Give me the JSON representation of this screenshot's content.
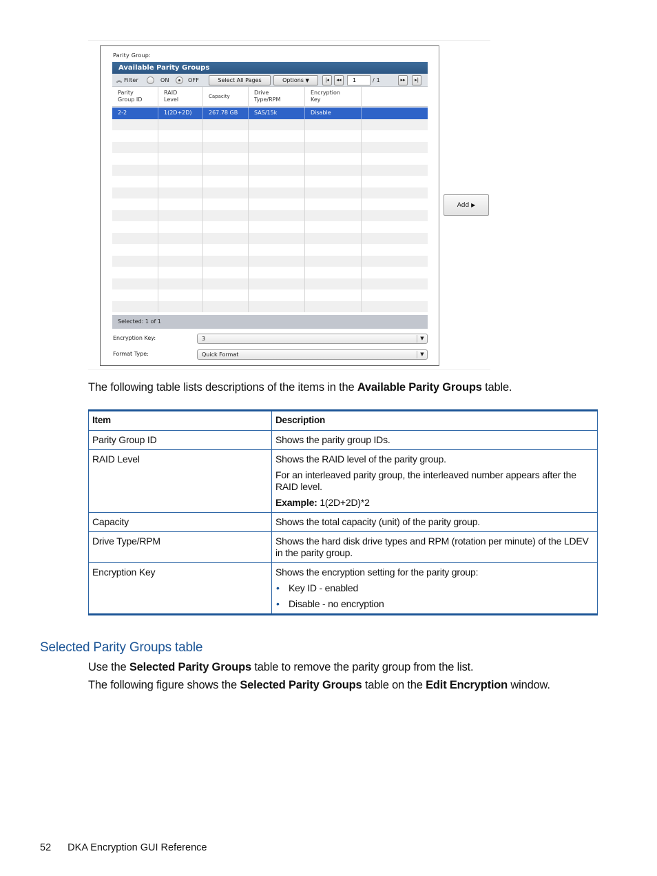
{
  "figure": {
    "parity_group_label": "Parity Group:",
    "grid_title": "Available Parity Groups",
    "toolbar": {
      "filter_label": "Filter",
      "filter_icon": "double-chevron-up-icon",
      "radio_on_label": "ON",
      "radio_off_label": "OFF",
      "filter_state": "OFF",
      "select_all_pages": "Select All Pages",
      "options": "Options",
      "first_page": "⏮",
      "prev_page": "◀◀",
      "page_value": "1",
      "page_total": "/ 1",
      "next_page": "▶▶",
      "last_page": "⏭"
    },
    "columns": [
      [
        "Parity",
        "Group ID"
      ],
      [
        "RAID",
        "Level"
      ],
      [
        "Capacity"
      ],
      [
        "Drive",
        "Type/RPM"
      ],
      [
        "Encryption",
        "Key"
      ],
      [
        ""
      ]
    ],
    "rows": [
      {
        "parity_group_id": "2-2",
        "raid_level": "1(2D+2D)",
        "capacity": "267.78 GB",
        "drive_type_rpm": "SAS/15k",
        "encryption_key": "Disable",
        "selected": true
      }
    ],
    "footer": "Selected:  1   of  1",
    "encryption_key_label": "Encryption Key:",
    "encryption_key_value": "3",
    "format_type_label": "Format Type:",
    "format_type_value": "Quick Format",
    "add_button": "Add"
  },
  "intro": {
    "before": "The following table lists descriptions of the items in the ",
    "bold": "Available Parity Groups",
    "after": " table."
  },
  "table": {
    "headers": [
      "Item",
      "Description"
    ],
    "rows": [
      {
        "item": "Parity Group ID",
        "desc": [
          "Shows the parity group IDs."
        ]
      },
      {
        "item": "RAID Level",
        "desc": [
          "Shows the RAID level of the parity group.",
          "For an interleaved parity group, the interleaved number appears after the RAID level."
        ],
        "example_label": "Example:",
        "example_value": " 1(2D+2D)*2"
      },
      {
        "item": "Capacity",
        "desc": [
          "Shows the total capacity (unit) of the parity group."
        ]
      },
      {
        "item": "Drive Type/RPM",
        "desc": [
          "Shows the hard disk drive types and RPM (rotation per minute) of the LDEV in the parity group."
        ]
      },
      {
        "item": "Encryption Key",
        "desc": [
          "Shows the encryption setting for the parity group:"
        ],
        "bullets": [
          "Key ID - enabled",
          "Disable - no encryption"
        ]
      }
    ]
  },
  "section": {
    "heading": "Selected Parity Groups table",
    "p1_before": "Use the ",
    "p1_bold": "Selected Parity Groups",
    "p1_after": " table to remove the parity group from the list.",
    "p2_before": "The following figure shows the ",
    "p2_bold1": "Selected Parity Groups",
    "p2_mid": " table on the ",
    "p2_bold2": "Edit Encryption",
    "p2_after": " window."
  },
  "footer": {
    "page_number": "52",
    "title": "DKA Encryption GUI Reference"
  }
}
